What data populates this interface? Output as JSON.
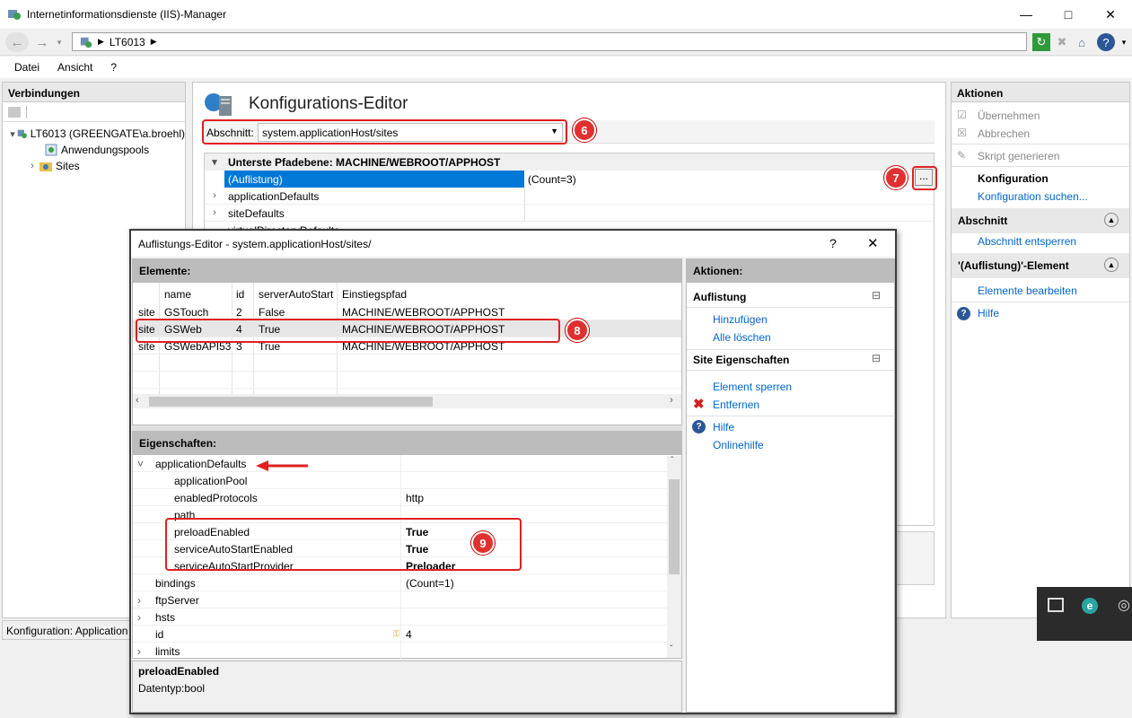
{
  "window": {
    "title": "Internetinformationsdienste (IIS)-Manager"
  },
  "address": {
    "server": "LT6013"
  },
  "menu": [
    "Datei",
    "Ansicht",
    "?"
  ],
  "connections": {
    "header": "Verbindungen",
    "server": "LT6013 (GREENGATE\\a.broehl)",
    "items": [
      "Anwendungspools",
      "Sites"
    ]
  },
  "editor": {
    "title": "Konfigurations-Editor",
    "section_label": "Abschnitt:",
    "section_value": "system.applicationHost/sites",
    "path_header": "Unterste Pfadebene: MACHINE/WEBROOT/APPHOST",
    "rows": [
      {
        "name": "(Auflistung)",
        "value": "(Count=3)"
      },
      {
        "name": "applicationDefaults",
        "value": ""
      },
      {
        "name": "siteDefaults",
        "value": ""
      },
      {
        "name": "virtualDirectoryDefaults",
        "value": ""
      }
    ],
    "ellipsis": "..."
  },
  "status": {
    "text": "Konfiguration: Application"
  },
  "actions": {
    "header": "Aktionen",
    "apply": "Übernehmen",
    "cancel": "Abbrechen",
    "script": "Skript generieren",
    "config": "Konfiguration",
    "config_search": "Konfiguration suchen...",
    "section_head": "Abschnitt",
    "section_unlock": "Abschnitt entsperren",
    "collection_head": "'(Auflistung)'-Element",
    "edit_items": "Elemente bearbeiten",
    "help": "Hilfe"
  },
  "dialog": {
    "title": "Auflistungs-Editor - system.applicationHost/sites/",
    "help_btn": "?",
    "elements_header": "Elemente:",
    "columns": [
      "",
      "name",
      "id",
      "serverAutoStart",
      "Einstiegspfad"
    ],
    "items": [
      [
        "site",
        "GSTouch",
        "2",
        "False",
        "MACHINE/WEBROOT/APPHOST"
      ],
      [
        "site",
        "GSWeb",
        "4",
        "True",
        "MACHINE/WEBROOT/APPHOST"
      ],
      [
        "site",
        "GSWebAPI53",
        "3",
        "True",
        "MACHINE/WEBROOT/APPHOST"
      ]
    ],
    "props_header": "Eigenschaften:",
    "props": [
      {
        "name": "applicationDefaults",
        "value": "",
        "level": 0,
        "expander": "open",
        "bold": false
      },
      {
        "name": "applicationPool",
        "value": "",
        "level": 1,
        "expander": "",
        "bold": false
      },
      {
        "name": "enabledProtocols",
        "value": "http",
        "level": 1,
        "expander": "",
        "bold": false
      },
      {
        "name": "path",
        "value": "",
        "level": 1,
        "expander": "",
        "bold": false
      },
      {
        "name": "preloadEnabled",
        "value": "True",
        "level": 1,
        "expander": "",
        "bold": true
      },
      {
        "name": "serviceAutoStartEnabled",
        "value": "True",
        "level": 1,
        "expander": "",
        "bold": true
      },
      {
        "name": "serviceAutoStartProvider",
        "value": "Preloader",
        "level": 1,
        "expander": "",
        "bold": true
      },
      {
        "name": "bindings",
        "value": "(Count=1)",
        "level": 0,
        "expander": "",
        "bold": false
      },
      {
        "name": "ftpServer",
        "value": "",
        "level": 0,
        "expander": "closed",
        "bold": false
      },
      {
        "name": "hsts",
        "value": "",
        "level": 0,
        "expander": "closed",
        "bold": false
      },
      {
        "name": "id",
        "value": "4",
        "level": 0,
        "expander": "",
        "bold": false
      },
      {
        "name": "limits",
        "value": "",
        "level": 0,
        "expander": "closed",
        "bold": false
      }
    ],
    "desc_title": "preloadEnabled",
    "desc_type": "Datentyp:bool",
    "actions": {
      "header": "Aktionen:",
      "collection_head": "Auflistung",
      "add": "Hinzufügen",
      "clear": "Alle löschen",
      "site_head": "Site Eigenschaften",
      "lock": "Element sperren",
      "remove": "Entfernen",
      "help": "Hilfe",
      "online_help": "Onlinehilfe"
    }
  },
  "callouts": [
    "6",
    "7",
    "8",
    "9"
  ],
  "colors": {
    "accent": "#0066cc",
    "highlight": "#0078d7",
    "callout": "#e03030"
  }
}
